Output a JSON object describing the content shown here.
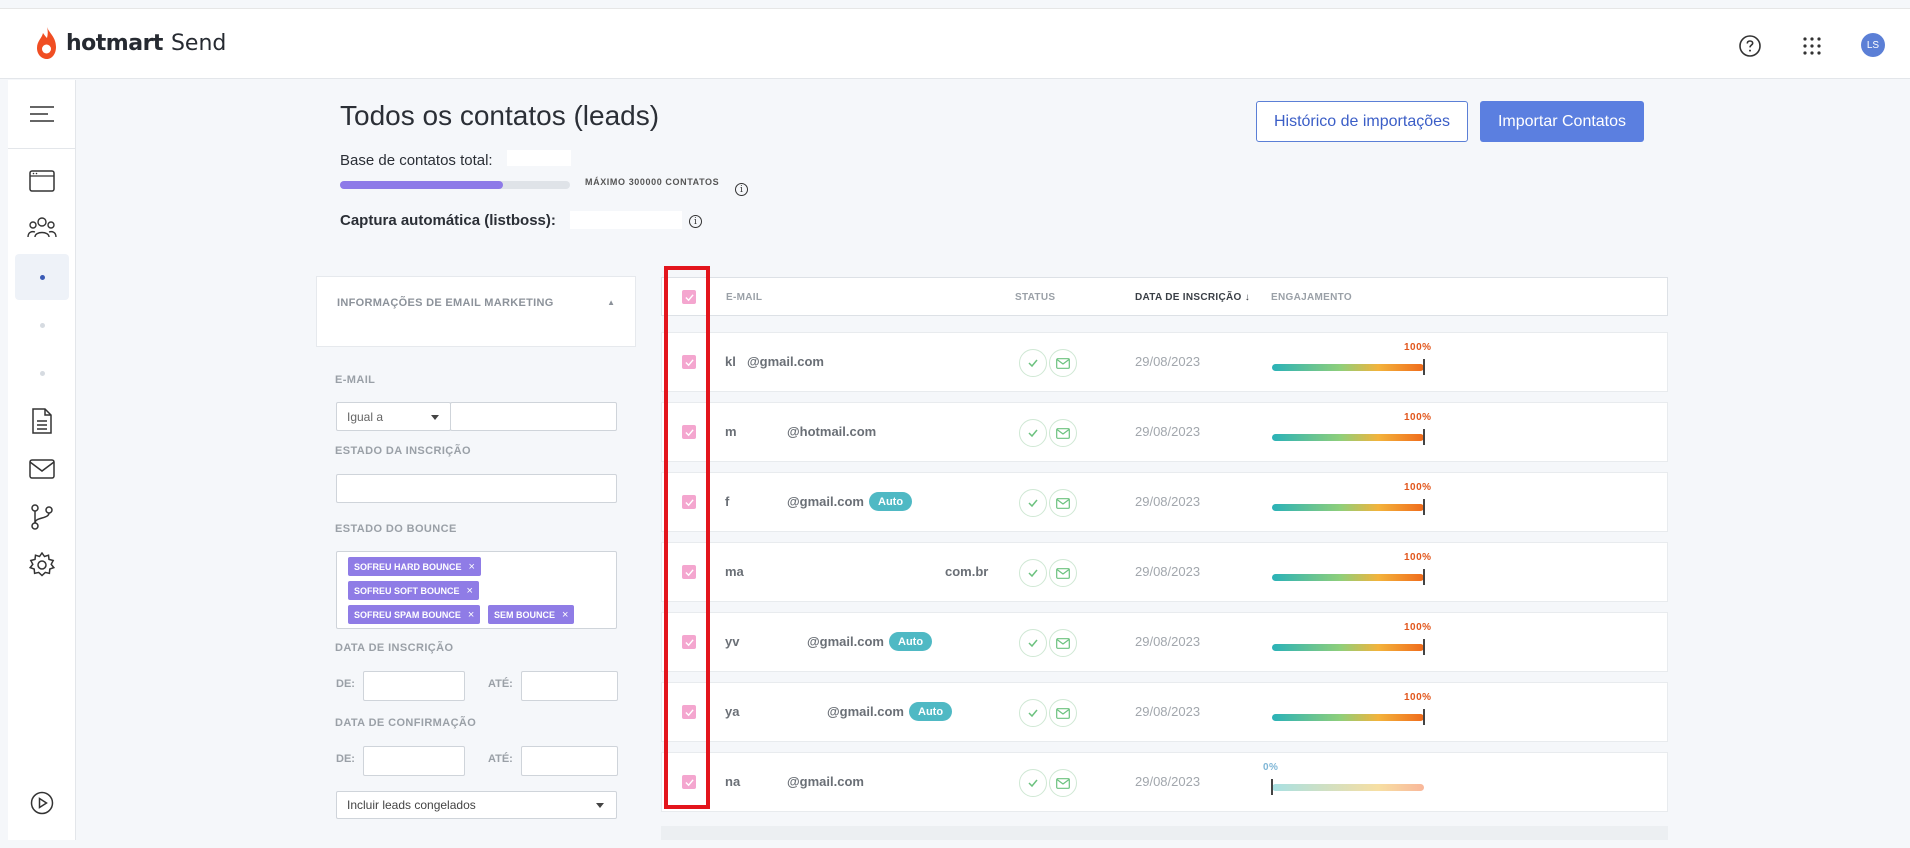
{
  "topbar": {
    "brand": "hotmart",
    "product": "Send",
    "avatar_initials": "LS",
    "icons": [
      "help-circle-icon",
      "apps-grid-icon"
    ]
  },
  "sidebar": {
    "items": [
      "menu-icon",
      "window-icon",
      "contacts-icon",
      "dot-active",
      "dot",
      "dot",
      "document-icon",
      "mail-icon",
      "flow-icon",
      "settings-icon",
      "play-icon"
    ]
  },
  "header": {
    "title": "Todos os contatos (leads)",
    "total_label": "Base de contatos total:",
    "capacity_fraction": 0.71,
    "max_label": "MÁXIMO 300000 CONTATOS",
    "listboss_label": "Captura automática (listboss): ",
    "history_button": "Histórico de importações",
    "import_button": "Importar Contatos"
  },
  "filters": {
    "panel_title": "INFORMAÇÕES DE EMAIL MARKETING",
    "email_label": "E-MAIL",
    "email_operator": "Igual a",
    "subscription_state_label": "ESTADO DA INSCRIÇÃO",
    "bounce_label": "ESTADO DO BOUNCE",
    "bounce_tags": [
      "SOFREU HARD BOUNCE",
      "SOFREU SOFT BOUNCE",
      "SOFREU SPAM BOUNCE",
      "SEM BOUNCE"
    ],
    "subscription_date_label": "DATA DE INSCRIÇÃO",
    "confirmation_date_label": "DATA DE CONFIRMAÇÃO",
    "from_label": "DE:",
    "to_label": "ATÉ:",
    "frozen_select": "Incluir leads congelados"
  },
  "table": {
    "columns": {
      "email": "E-MAIL",
      "status": "STATUS",
      "date": "DATA DE INSCRIÇÃO",
      "engagement": "ENGAJAMENTO"
    },
    "rows": [
      {
        "email_start": "kl",
        "email_end": "@gmail.com",
        "auto": false,
        "date": "29/08/2023",
        "engagement": "100%"
      },
      {
        "email_start": "m",
        "email_end": "@hotmail.com",
        "auto": false,
        "date": "29/08/2023",
        "engagement": "100%"
      },
      {
        "email_start": "f",
        "email_end": "@gmail.com",
        "auto": true,
        "date": "29/08/2023",
        "engagement": "100%"
      },
      {
        "email_start": "ma",
        "email_end": "com.br",
        "auto": false,
        "date": "29/08/2023",
        "engagement": "100%"
      },
      {
        "email_start": "yv",
        "email_end": "@gmail.com",
        "auto": true,
        "date": "29/08/2023",
        "engagement": "100%"
      },
      {
        "email_start": "ya",
        "email_end": "@gmail.com",
        "auto": true,
        "date": "29/08/2023",
        "engagement": "100%"
      },
      {
        "email_start": "na",
        "email_end": "@gmail.com",
        "auto": false,
        "date": "29/08/2023",
        "engagement": "0%"
      }
    ],
    "auto_badge": "Auto"
  },
  "colors": {
    "primary": "#5b7fe0",
    "checkbox": "#f4a6cf",
    "tag": "#8f7ce6",
    "badge": "#4fb9c4",
    "highlight": "#e3151c"
  }
}
